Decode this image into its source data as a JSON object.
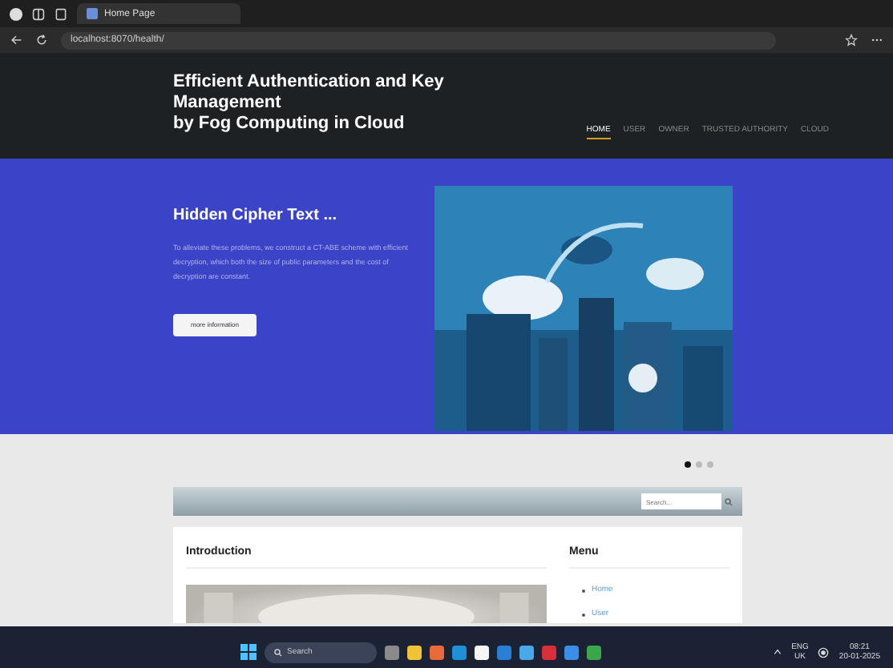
{
  "browser": {
    "tab_title": "Home Page",
    "address": "localhost:8070/health/"
  },
  "site": {
    "title_lines": [
      "Efficient Authentication and Key",
      "Management",
      "by Fog Computing in Cloud"
    ],
    "nav": [
      {
        "label": "HOME",
        "selected": true
      },
      {
        "label": "USER",
        "selected": false
      },
      {
        "label": "OWNER",
        "selected": false
      },
      {
        "label": "TRUSTED AUTHORITY",
        "selected": false
      },
      {
        "label": "CLOUD",
        "selected": false
      }
    ]
  },
  "hero": {
    "title": "Hidden Cipher Text ...",
    "text": "To alleviate these problems, we construct a CT-ABE scheme with efficient decryption, which both the size of public parameters and the cost of decryption are constant.",
    "button": "more information",
    "dots": [
      {
        "selected": true
      },
      {
        "selected": false
      },
      {
        "selected": false
      }
    ]
  },
  "search": {
    "placeholder": "Search..."
  },
  "intro": {
    "heading": "Introduction"
  },
  "menu": {
    "heading": "Menu",
    "items": [
      "Home",
      "User"
    ]
  },
  "taskbar": {
    "search": "Search",
    "lang": [
      "ENG",
      "UK"
    ],
    "time": "08:21",
    "date": "20-01-2025"
  }
}
